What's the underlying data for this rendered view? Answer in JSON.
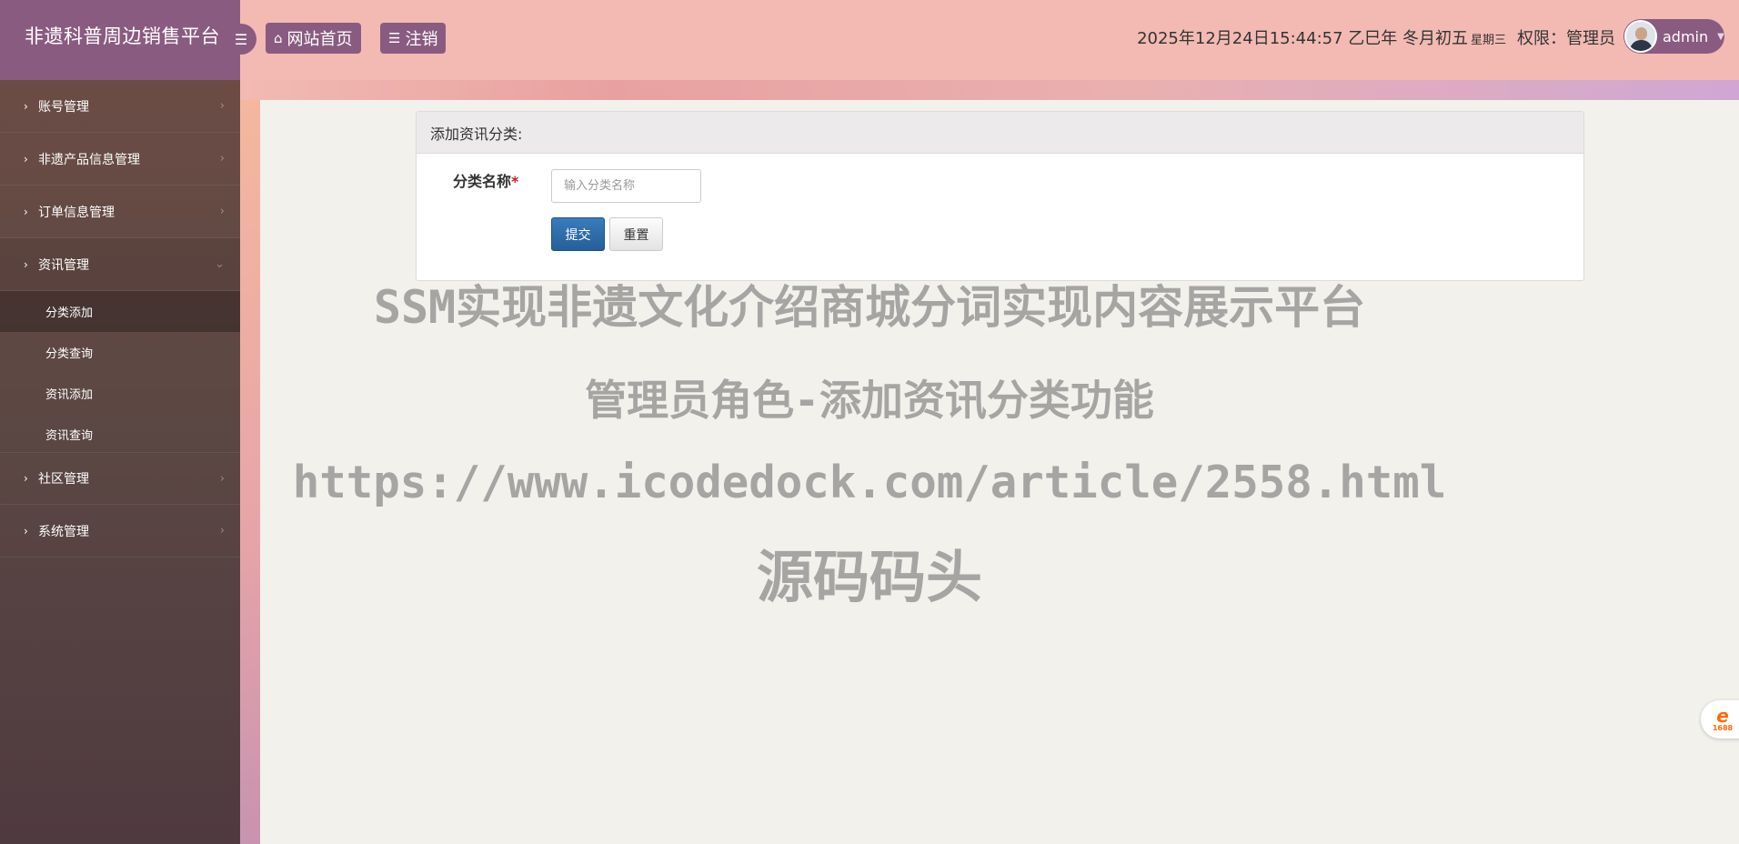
{
  "header": {
    "brand_title": "非遗科普周边销售平台",
    "menu_toggle_icon": "bars-icon",
    "home_button": "网站首页",
    "logout_button": "注销",
    "datetime": "2025年12月24日15:44:57 乙巳年 冬月初五",
    "weekday": "星期三",
    "role": "权限：管理员",
    "username": "admin",
    "caret_icon": "caret-down-icon"
  },
  "sidebar": {
    "items": [
      {
        "label": "账号管理",
        "open": false
      },
      {
        "label": "非遗产品信息管理",
        "open": false
      },
      {
        "label": "订单信息管理",
        "open": false
      },
      {
        "label": "资讯管理",
        "open": true,
        "subitems": [
          "分类添加",
          "分类查询",
          "资讯添加",
          "资讯查询"
        ],
        "active_subitem": "分类添加"
      },
      {
        "label": "社区管理",
        "open": false
      },
      {
        "label": "系统管理",
        "open": false
      }
    ]
  },
  "form": {
    "panel_title": "添加资讯分类:",
    "field_label": "分类名称",
    "required_mark": "*",
    "field_placeholder": "输入分类名称",
    "field_value": "",
    "submit_label": "提交",
    "reset_label": "重置"
  },
  "watermark": {
    "line1": "SSM实现非遗文化介绍商城分词实现内容展示平台",
    "line2": "管理员角色-添加资讯分类功能",
    "line3": "https://www.icodedock.com/article/2558.html",
    "line4": "源码码头"
  },
  "float_badge": {
    "glyph": "e",
    "number": "1688"
  },
  "colors": {
    "header_bg": "#f2bab3",
    "brand_bg": "#8a5b81",
    "sidebar_bg": "#5b4743",
    "submit_bg": "#2a6aa8",
    "required": "#d9191f"
  }
}
